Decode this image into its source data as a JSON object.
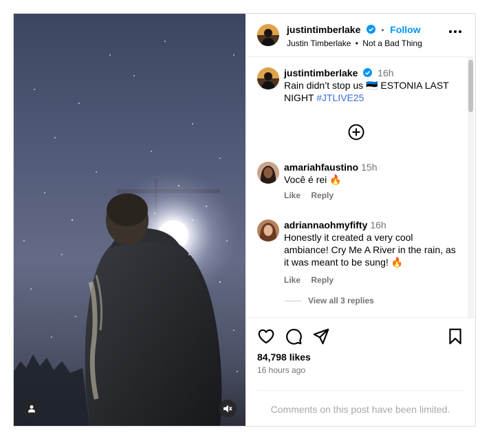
{
  "post": {
    "username": "justintimberlake",
    "follow_label": "Follow",
    "separator": "•",
    "subtitle_name": "Justin Timberlake",
    "subtitle_song": "Not a Bad Thing"
  },
  "caption": {
    "username": "justintimberlake",
    "time": "16h",
    "text": "Rain didn’t stop us 🇪🇪 ESTONIA LAST NIGHT ",
    "hashtag": "#JTLIVE25"
  },
  "comments": [
    {
      "username": "amariahfaustino",
      "time": "15h",
      "text": "Você é rei 🔥",
      "like": "Like",
      "reply": "Reply"
    },
    {
      "username": "adriannaohmyfifty",
      "time": "16h",
      "text": "Honestly it created a very cool ambiance! Cry Me A River in the rain, as it was meant to be sung! 🔥",
      "like": "Like",
      "reply": "Reply"
    }
  ],
  "view_replies": "View all 3 replies",
  "likes_label": "84,798 likes",
  "posted_ago": "16 hours ago",
  "comments_limited": "Comments on this post have been limited.",
  "icons": {
    "verified": "verified-badge-icon",
    "more": "more-options-icon",
    "add_comment": "add-circle-icon",
    "like": "heart-icon",
    "comment": "comment-icon",
    "share": "send-icon",
    "save": "bookmark-icon",
    "tagged": "user-tag-icon",
    "mute": "muted-speaker-icon"
  },
  "colors": {
    "link": "#0095f6",
    "verified": "#0095f6",
    "hashtag": "#3a6fd8",
    "secondary_text": "#737373"
  }
}
